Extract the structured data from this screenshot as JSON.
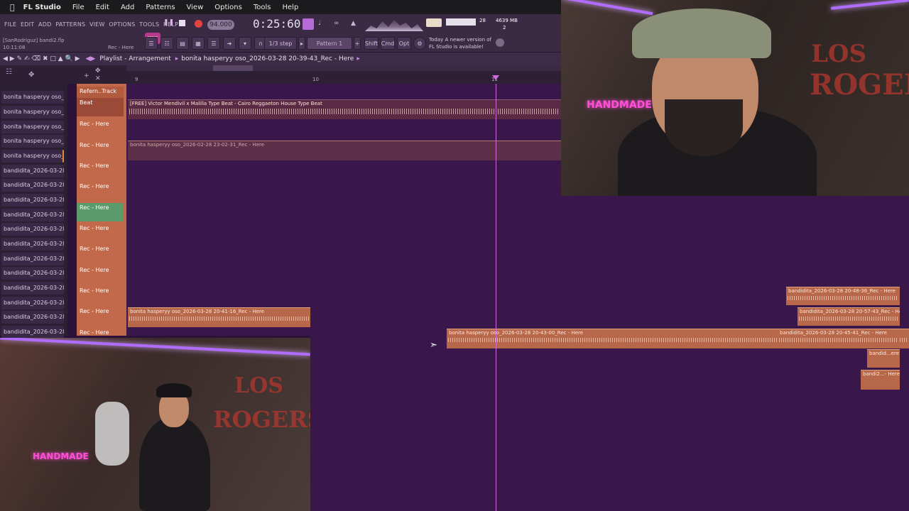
{
  "mac_menu": {
    "app": "FL Studio",
    "items": [
      "File",
      "Edit",
      "Add",
      "Patterns",
      "View",
      "Options",
      "Tools",
      "Help"
    ]
  },
  "fl_menu": [
    "FILE",
    "EDIT",
    "ADD",
    "PATTERNS",
    "VIEW",
    "OPTIONS",
    "TOOLS",
    "HELP"
  ],
  "transport": {
    "song_label": "SONG",
    "tempo": "94.000",
    "time": "0:25:60",
    "snap": "1/3 step",
    "pattern": "Pattern 1",
    "shift": "Shift",
    "cmd": "Cmd",
    "opt": "Opt",
    "cpu": "28",
    "mem": "4639 MB",
    "voices": "2"
  },
  "project": {
    "file": "[SanRodriguz] bandi2.flp",
    "clock": "10:11:08",
    "hint": "Rec - Here"
  },
  "news": {
    "line1": "Today  A newer version of",
    "line2": "FL Studio is available!"
  },
  "playlist": {
    "title": "Playlist - Arrangement",
    "crumb": "bonita hasperyy oso_2026-03-28 20-39-43_Rec - Here",
    "ruler": [
      "9",
      "10",
      "11"
    ]
  },
  "browser": [
    "bonita hasperyy oso_20...",
    "bonita hasperyy oso_20...",
    "bonita hasperyy oso_20...",
    "bonita hasperyy oso_20...",
    "bonita hasperyy oso_20...",
    "bandidita_2026-03-28 2...",
    "bandidita_2026-03-28 2...",
    "bandidita_2026-03-28 2...",
    "bandidita_2026-03-28 2...",
    "bandidita_2026-03-28 2...",
    "bandidita_2026-03-28 2...",
    "bandidita_2026-03-28 2...",
    "bandidita_2026-03-28 2...",
    "bandidita_2026-03-28 2...",
    "bandidita_2026-03-28 2...",
    "bandidita_2026-03-28 2...",
    "bandidita_2026-03-28 2..."
  ],
  "tracks": [
    "Refern..Track",
    "Beat",
    "Rec - Here",
    "Rec - Here",
    "Rec - Here",
    "Rec - Here",
    "Rec - Here",
    "Rec - Here",
    "Rec - Here",
    "Rec - Here",
    "Rec - Here",
    "Rec - Here",
    "Rec - Here",
    "Rec - Here"
  ],
  "clips": {
    "beat": "[FREE] Victor Mendivil x Malilla Type Beat - Cairo  Reggaeton House Type Beat",
    "ghost": "bonita hasperyy oso_2026-02-28 23-02-31_Rec - Here",
    "c1": "bonita hasperyy oso_2026-03-28 20-41-16_Rec - Here",
    "c2": "bonita hasperyy oso_2026-03-28 20-43-00_Rec - Here",
    "c3": "bandidita_2026-03-28 20-48-36_Rec - Here",
    "c4": "bandidita_2026-03-28 20-57-43_Rec - Here",
    "c5": "bandidita_2026-03-28 20-45-41_Rec - Here",
    "c6": "bandid...ere",
    "c7": "bandi2...- Here"
  },
  "webcam": {
    "graffiti": "ROGERS",
    "neon_text": "HANDMADE",
    "graffiti_big": "LOS"
  },
  "colors": {
    "accent": "#b73a8d",
    "clip": "#b8684a",
    "grid": "#3a174a",
    "playhead": "#d36bdf"
  }
}
